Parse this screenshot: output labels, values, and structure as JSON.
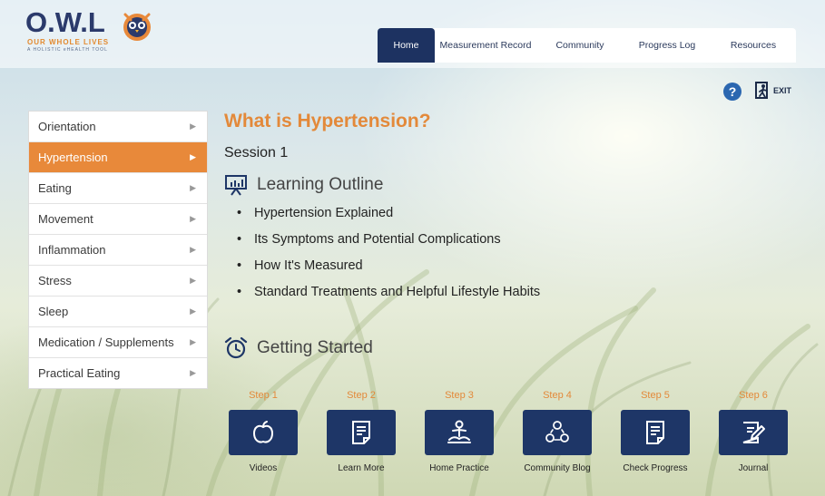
{
  "logo": {
    "text": "O.W.L",
    "tagline": "OUR WHOLE LIVES",
    "subtagline": "A HOLISTIC eHEALTH TOOL"
  },
  "nav": {
    "tabs": [
      {
        "label": "Home",
        "active": true
      },
      {
        "label": "Measurement Record",
        "active": false
      },
      {
        "label": "Community",
        "active": false
      },
      {
        "label": "Progress Log",
        "active": false
      },
      {
        "label": "Resources",
        "active": false
      }
    ]
  },
  "header_actions": {
    "help_icon": "question-circle",
    "exit_label": "EXIT"
  },
  "sidebar": {
    "items": [
      {
        "label": "Orientation",
        "active": false
      },
      {
        "label": "Hypertension",
        "active": true
      },
      {
        "label": "Eating",
        "active": false
      },
      {
        "label": "Movement",
        "active": false
      },
      {
        "label": "Inflammation",
        "active": false
      },
      {
        "label": "Stress",
        "active": false
      },
      {
        "label": "Sleep",
        "active": false
      },
      {
        "label": "Medication / Supplements",
        "active": false
      },
      {
        "label": "Practical Eating",
        "active": false
      }
    ]
  },
  "main": {
    "title": "What is Hypertension?",
    "session": "Session 1",
    "learning_outline": {
      "heading": "Learning Outline",
      "items": [
        "Hypertension Explained",
        "Its Symptoms and Potential Complications",
        "How It's Measured",
        "Standard Treatments and Helpful Lifestyle Habits"
      ]
    },
    "getting_started": {
      "heading": "Getting Started"
    },
    "steps": [
      {
        "step": "Step 1",
        "caption": "Videos",
        "icon": "apple-icon"
      },
      {
        "step": "Step 2",
        "caption": "Learn More",
        "icon": "document-icon"
      },
      {
        "step": "Step 3",
        "caption": "Home Practice",
        "icon": "meditation-icon"
      },
      {
        "step": "Step 4",
        "caption": "Community Blog",
        "icon": "community-icon"
      },
      {
        "step": "Step 5",
        "caption": "Check Progress",
        "icon": "checklist-icon"
      },
      {
        "step": "Step 6",
        "caption": "Journal",
        "icon": "journal-icon"
      }
    ]
  },
  "colors": {
    "accent_orange": "#e8893a",
    "navy": "#1d3261",
    "tile_navy": "#1e3667"
  }
}
